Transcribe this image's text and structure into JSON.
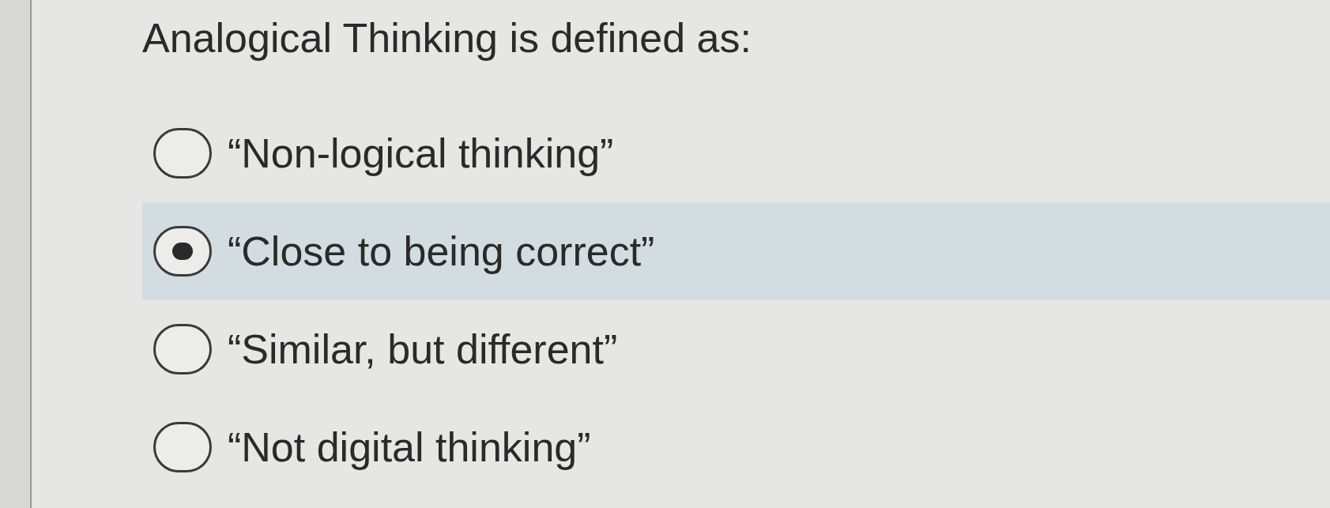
{
  "question": {
    "title": "Analogical Thinking is defined as:"
  },
  "options": [
    {
      "label": "“Non-logical thinking”",
      "selected": false
    },
    {
      "label": "“Close to being correct”",
      "selected": true
    },
    {
      "label": "“Similar, but different”",
      "selected": false
    },
    {
      "label": "“Not digital thinking”",
      "selected": false
    }
  ]
}
